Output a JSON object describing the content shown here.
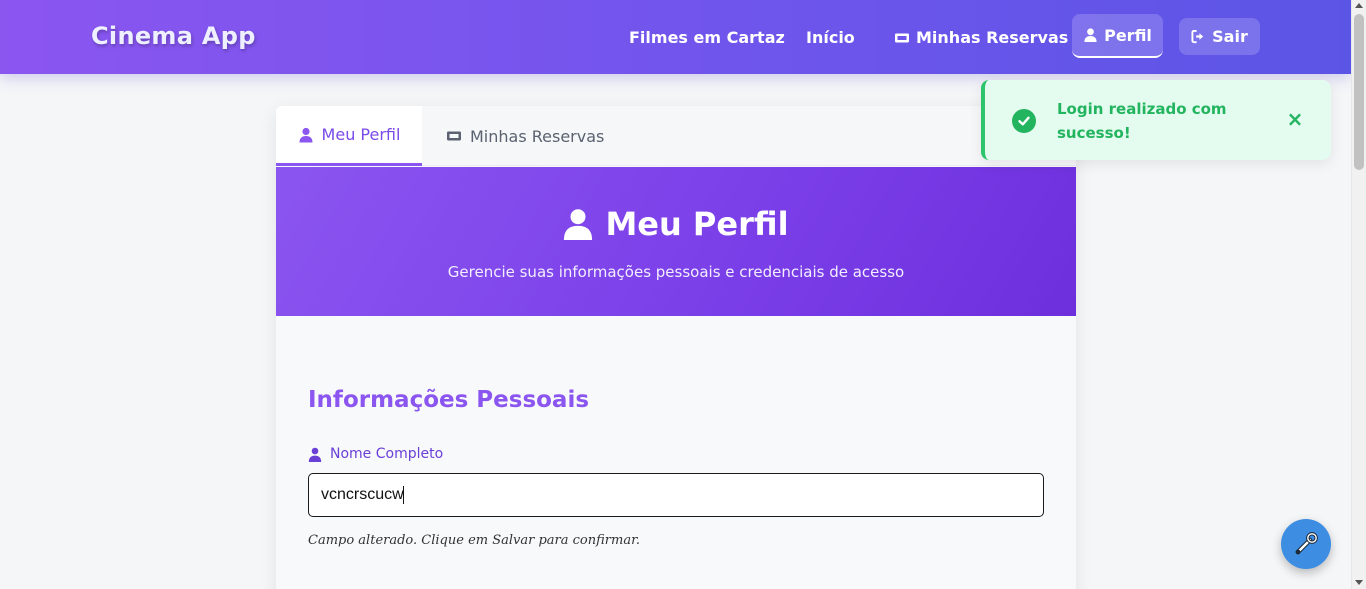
{
  "navbar": {
    "brand": "Cinema App",
    "links": [
      {
        "label": "Filmes em Cartaz"
      },
      {
        "label": "Início"
      },
      {
        "label": "Minhas Reservas",
        "icon": "ticket-icon"
      },
      {
        "label": "Perfil",
        "icon": "user-icon",
        "active": true
      },
      {
        "label": "Sair",
        "icon": "sign-out-icon"
      }
    ]
  },
  "tabs": [
    {
      "label": "Meu Perfil",
      "icon": "user-icon",
      "active": true
    },
    {
      "label": "Minhas Reservas",
      "icon": "ticket-icon",
      "active": false
    }
  ],
  "hero": {
    "title": "Meu Perfil",
    "subtitle": "Gerencie suas informações pessoais e credenciais de acesso"
  },
  "personal_info": {
    "section_title": "Informações Pessoais",
    "name_label": "Nome Completo",
    "name_value": "vcncrscucw",
    "hint": "Campo alterado. Clique em Salvar para confirmar."
  },
  "toast": {
    "message": "Login realizado com sucesso!",
    "close": "×",
    "icon": "check-circle-icon"
  },
  "fab": {
    "icon": "wrench-icon"
  },
  "colors": {
    "accent": "#8b55f0",
    "success": "#22b45e",
    "fab": "#3d8ee2"
  }
}
